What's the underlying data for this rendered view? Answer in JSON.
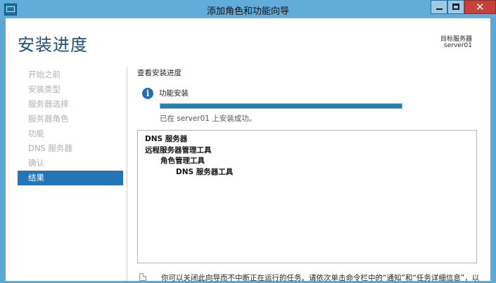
{
  "window": {
    "title": "添加角色和功能向导",
    "close_glyph": "✕"
  },
  "header": {
    "heading": "安装进度",
    "target_label": "目标服务器",
    "target_server": "server01"
  },
  "nav": {
    "items": [
      {
        "label": "开始之前",
        "active": false
      },
      {
        "label": "安装类型",
        "active": false
      },
      {
        "label": "服务器选择",
        "active": false
      },
      {
        "label": "服务器角色",
        "active": false
      },
      {
        "label": "功能",
        "active": false
      },
      {
        "label": "DNS 服务器",
        "active": false
      },
      {
        "label": "确认",
        "active": false
      },
      {
        "label": "结果",
        "active": true
      }
    ]
  },
  "main": {
    "section_title": "查看安装进度",
    "info_glyph": "i",
    "feature_label": "功能安装",
    "progress": 1.0,
    "status_text": "已在 server01 上安装成功。",
    "results": [
      {
        "text": "DNS 服务器",
        "level": 0
      },
      {
        "text": "远程服务器管理工具",
        "level": 0
      },
      {
        "text": "角色管理工具",
        "level": 1
      },
      {
        "text": "DNS 服务器工具",
        "level": 2
      }
    ],
    "note_text": "你可以关闭此向导而不中断正在运行的任务。请依次单击命令栏中的“通知”和“任务详细信息”，以"
  },
  "colors": {
    "accent": "#2276b8",
    "progress": "#1e82b8",
    "title_bar": "#62acd9",
    "close_button": "#c7413b"
  }
}
